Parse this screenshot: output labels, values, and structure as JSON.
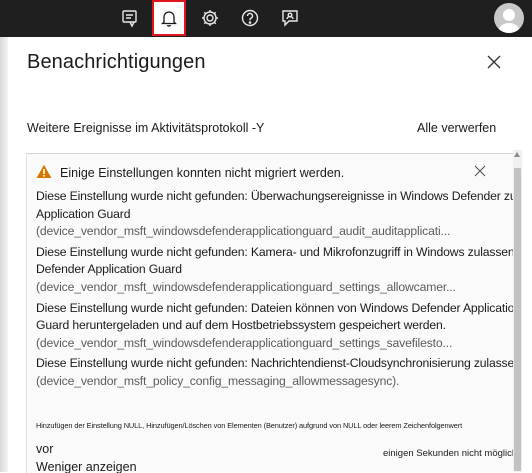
{
  "topbar": {
    "icons": [
      "feedback-cloud-icon",
      "bell-icon",
      "gear-icon",
      "help-icon",
      "chat-person-icon"
    ],
    "avatar": "avatar"
  },
  "panel": {
    "title": "Benachrichtigungen",
    "activity_link": "Weitere Ereignisse im Aktivitätsprotokoll -Y",
    "dismiss_all": "Alle verwerfen"
  },
  "card": {
    "title": "Einige Einstellungen konnten nicht migriert werden.",
    "messages": [
      {
        "line1": "Diese Einstellung wurde nicht gefunden: Überwachungsereignisse in Windows Defender zulassen",
        "line2": "Application Guard",
        "code": "(device_vendor_msft_windowsdefenderapplicationguard_audit_auditapplicati..."
      },
      {
        "line1": "Diese Einstellung wurde nicht gefunden: Kamera- und Mikrofonzugriff in Windows zulassen",
        "line2": "Defender Application Guard",
        "code": "(device_vendor_msft_windowsdefenderapplicationguard_settings_allowcamer..."
      },
      {
        "line1": "Diese Einstellung wurde nicht gefunden: Dateien können von Windows Defender Application",
        "line2": "Guard heruntergeladen und auf dem Hostbetriebssystem gespeichert werden.",
        "code": "(device_vendor_msft_windowsdefenderapplicationguard_settings_savefilesto..."
      },
      {
        "line1": "Diese Einstellung wurde nicht gefunden: Nachrichtendienst-Cloudsynchronisierung zulassen",
        "line2": "",
        "code": "(device_vendor_msft_policy_config_messaging_allowmessagesync)."
      }
    ],
    "tiny_note": "Hinzufügen der Einstellung NULL, Hinzufügen/Löschen von Elementen (Benutzer) aufgrund von NULL oder leerem Zeichenfolgenwert",
    "vor": "vor",
    "less_link": "Weniger anzeigen",
    "time_note": "einigen Sekunden nicht möglich"
  },
  "colors": {
    "topbar_bg": "#1f1f1f",
    "bell_highlight": "#e0141e",
    "warning": "#d47500"
  }
}
